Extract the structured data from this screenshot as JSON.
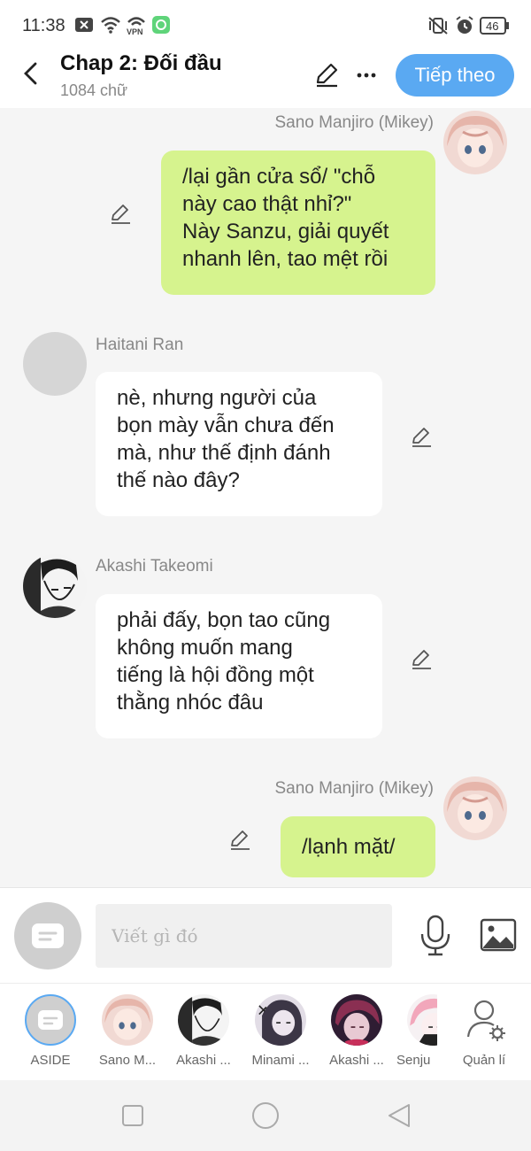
{
  "status_bar": {
    "time": "11:38",
    "vpn_label": "VPN",
    "battery": "46"
  },
  "header": {
    "title": "Chap 2: Đối đầu",
    "word_count": "1084 chữ",
    "next_label": "Tiếp theo"
  },
  "messages": [
    {
      "side": "right",
      "name": "Sano Manjiro (Mikey)",
      "lines": [
        "/lại gần cửa sổ/ \"chỗ",
        "này cao thật nhỉ?\"",
        "Này Sanzu, giải quyết",
        "nhanh lên, tao mệt rồi"
      ]
    },
    {
      "side": "left",
      "name": "Haitani Ran",
      "lines": [
        "nè, nhưng người của",
        "bọn mày vẫn chưa đến",
        "mà, như thế định đánh",
        "thế nào đây?"
      ]
    },
    {
      "side": "left",
      "name": "Akashi Takeomi",
      "lines": [
        "phải đấy, bọn tao cũng",
        "không muốn mang",
        "tiếng là hội đồng một",
        "thằng nhóc đâu"
      ]
    },
    {
      "side": "right",
      "name": "Sano Manjiro (Mikey)",
      "lines": [
        "/lạnh mặt/"
      ]
    }
  ],
  "input": {
    "placeholder": "Viết gì đó"
  },
  "characters": [
    {
      "label": "ASIDE"
    },
    {
      "label": "Sano M..."
    },
    {
      "label": "Akashi ..."
    },
    {
      "label": "Minami ..."
    },
    {
      "label": "Akashi ..."
    },
    {
      "label": "Senju"
    },
    {
      "label": "Quản lí"
    }
  ],
  "colors": {
    "accent": "#5aa9f2",
    "right_bubble": "#d6f38e",
    "left_bubble": "#ffffff",
    "background": "#f5f5f5"
  },
  "icons": {
    "back": "chevron-left-icon",
    "edit": "pencil-icon",
    "more": "more-horizontal-icon",
    "mic": "microphone-icon",
    "image": "image-icon",
    "manage": "user-gear-icon"
  }
}
